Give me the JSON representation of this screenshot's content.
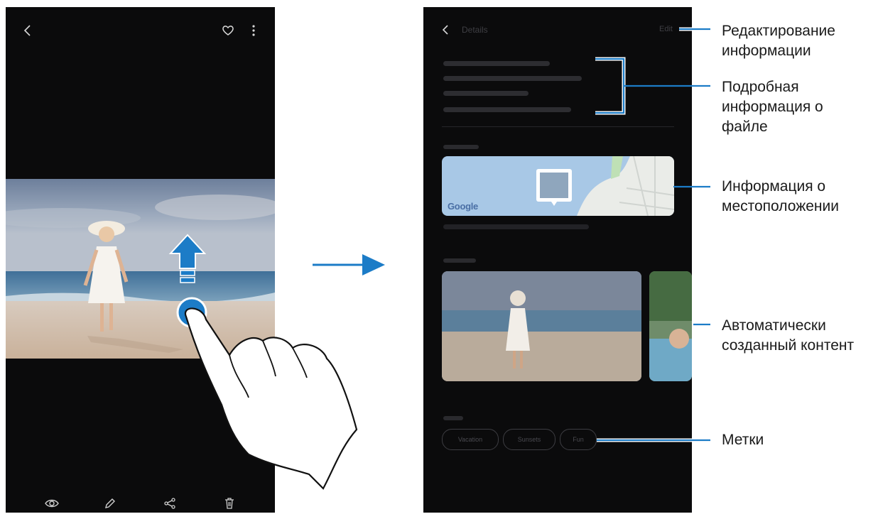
{
  "right_screen": {
    "header_title": "Details",
    "edit_label": "Edit",
    "tags": [
      "Vacation",
      "Sunsets",
      "Fun"
    ],
    "map_provider": "Google"
  },
  "callouts": {
    "edit_info": "Редактирование информации",
    "file_details": "Подробная информация о файле",
    "location_info": "Информация о местоположении",
    "auto_content": "Автоматически созданный контент",
    "tags": "Метки"
  },
  "colors": {
    "phone_bg": "#0b0b0c",
    "accent_blue": "#1c7cc7",
    "callout_line": "#1c7cc7"
  },
  "icons": {
    "left_top": [
      "back-chevron-icon",
      "heart-icon",
      "more-vertical-icon"
    ],
    "left_bottom": [
      "bixby-vision-eye-icon",
      "edit-pencil-icon",
      "share-icon",
      "delete-trash-icon"
    ],
    "gesture": [
      "swipe-up-arrow-icon",
      "tap-circle-icon",
      "hand-pointer-icon",
      "transition-arrow-icon"
    ]
  }
}
